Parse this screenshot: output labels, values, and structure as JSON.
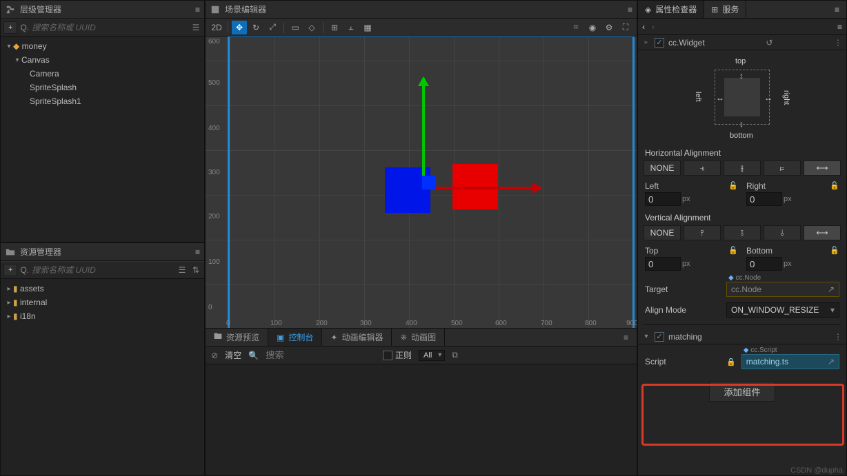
{
  "hierarchy": {
    "title": "层级管理器",
    "search_placeholder": "搜索名称或 UUID",
    "search_prefix": "Q.",
    "nodes": {
      "root": "money",
      "canvas": "Canvas",
      "children": [
        "Camera",
        "SpriteSplash",
        "SpriteSplash1"
      ]
    }
  },
  "assets": {
    "title": "资源管理器",
    "search_placeholder": "搜索名称或 UUID",
    "search_prefix": "Q.",
    "folders": [
      "assets",
      "internal",
      "i18n"
    ]
  },
  "scene": {
    "title": "场景编辑器",
    "mode2d": "2D",
    "ruler_y": [
      "600",
      "500",
      "400",
      "300",
      "200",
      "100",
      "0"
    ],
    "ruler_x": [
      "0",
      "100",
      "200",
      "300",
      "400",
      "500",
      "600",
      "700",
      "800",
      "900"
    ]
  },
  "bottom": {
    "tabs": [
      "资源预览",
      "控制台",
      "动画编辑器",
      "动画图"
    ],
    "clear": "清空",
    "search_placeholder": "搜索",
    "regex": "正则",
    "filter": "All"
  },
  "inspector": {
    "tabs": [
      "属性检查器",
      "服务"
    ],
    "component1": "cc.Widget",
    "widget_labels": {
      "top": "top",
      "bottom": "bottom",
      "left": "left",
      "right": "right"
    },
    "h_align_label": "Horizontal Alignment",
    "v_align_label": "Vertical Alignment",
    "none": "NONE",
    "left_label": "Left",
    "right_label": "Right",
    "top_label": "Top",
    "bottom_label": "Bottom",
    "val_left": "0",
    "unit": "px",
    "val_right": "0",
    "val_top": "0",
    "val_bottom": "0",
    "target_label": "Target",
    "target_tag": "cc.Node",
    "target_value": "cc.Node",
    "alignmode_label": "Align Mode",
    "alignmode_value": "ON_WINDOW_RESIZE",
    "component2": "matching",
    "script_label": "Script",
    "script_tag": "cc.Script",
    "script_value": "matching.ts",
    "add_component": "添加组件"
  },
  "watermark": "CSDN @dupha"
}
